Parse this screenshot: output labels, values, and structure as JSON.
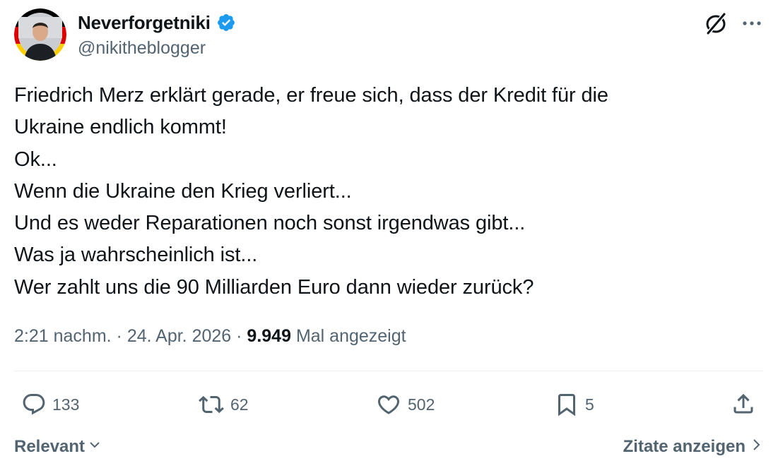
{
  "author": {
    "display_name": "Neverforgetniki",
    "handle": "@nikitheblogger",
    "verified": true,
    "avatar_icon": "avatar-photo-german-flag-ring"
  },
  "header_actions": {
    "grok_icon": "grok-icon",
    "more_icon": "more-horizontal-icon"
  },
  "tweet": {
    "lines": [
      "Friedrich Merz erklärt gerade, er freue sich, dass der Kredit für die",
      "Ukraine endlich kommt!",
      "Ok...",
      "Wenn die Ukraine den Krieg verliert...",
      "Und es weder Reparationen noch sonst irgendwas gibt...",
      "Was ja wahrscheinlich ist...",
      "Wer zahlt uns die 90 Milliarden Euro dann wieder zurück?"
    ],
    "time": "2:21 nachm.",
    "separator": "·",
    "date": "24. Apr. 2026",
    "views_count": "9.949",
    "views_label": "Mal angezeigt"
  },
  "actions": {
    "replies": "133",
    "reposts": "62",
    "likes": "502",
    "bookmarks": "5"
  },
  "footer": {
    "sort_label": "Relevant",
    "quotes_label": "Zitate anzeigen"
  },
  "colors": {
    "text_primary": "#0f1419",
    "text_secondary": "#536471",
    "verified_blue": "#1d9bf0",
    "divider": "#eff3f4"
  }
}
